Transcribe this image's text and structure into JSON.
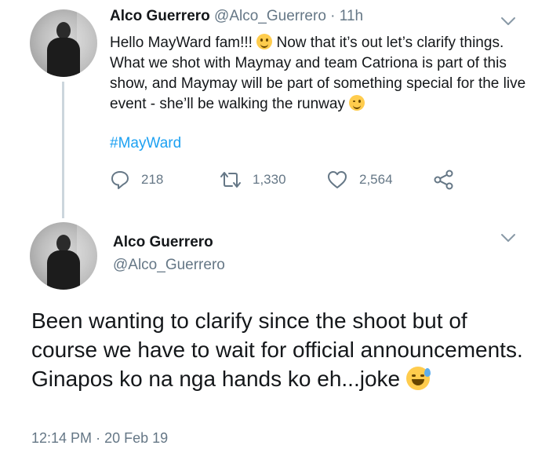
{
  "first_tweet": {
    "display_name": "Alco Guerrero",
    "handle": "@Alco_Guerrero",
    "separator": "·",
    "time": "11h",
    "text_1": "Hello MayWard fam!!! ",
    "text_2": " Now that it’s out let’s clarify things. What we shot with Maymay and team Catriona is part of this show, and Maymay will be part of something special for the live event - she’ll be walking the runway ",
    "hashtag": "#MayWard",
    "reply_count": "218",
    "retweet_count": "1,330",
    "like_count": "2,564"
  },
  "second_tweet": {
    "display_name": "Alco Guerrero",
    "handle": "@Alco_Guerrero",
    "text": "Been wanting to clarify since the shoot but of course we have to wait for official announcements. Ginapos ko na nga hands ko eh...joke ",
    "time": "12:14 PM",
    "separator": "·",
    "date": "20 Feb 19"
  },
  "icons": {
    "reply": "reply-icon",
    "retweet": "retweet-icon",
    "like": "heart-icon",
    "share": "share-icon",
    "menu": "chevron-down-icon"
  },
  "colors": {
    "link": "#1da1f2",
    "muted": "#657786",
    "text": "#14171a"
  }
}
